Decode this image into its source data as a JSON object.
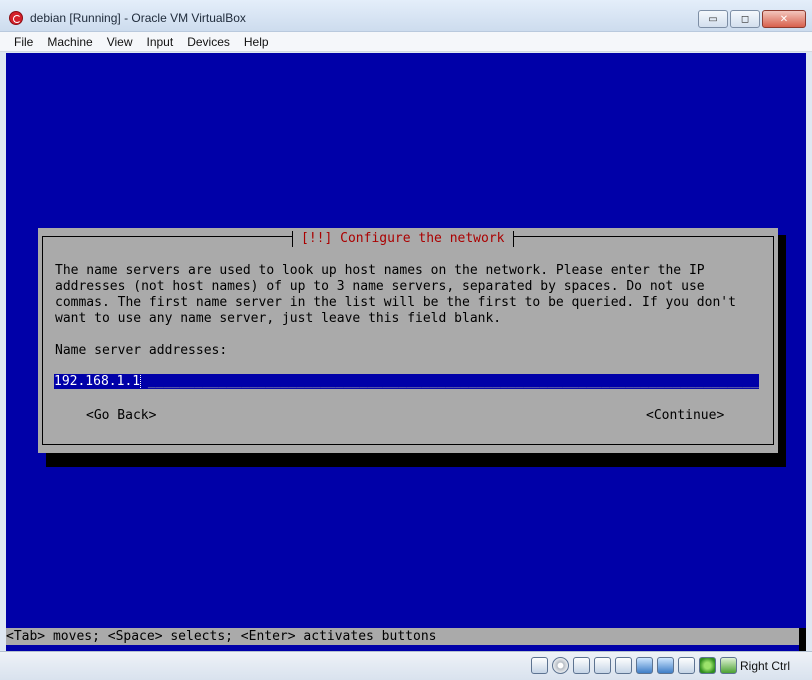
{
  "window": {
    "title": "debian [Running] - Oracle VM VirtualBox",
    "minimize": "▭",
    "maximize": "◻",
    "close": "✕"
  },
  "menu": {
    "file": "File",
    "machine": "Machine",
    "view": "View",
    "input": "Input",
    "devices": "Devices",
    "help": "Help"
  },
  "dialog": {
    "title": "[!!] Configure the network",
    "description": "The name servers are used to look up host names on the network. Please enter the IP\naddresses (not host names) of up to 3 name servers, separated by spaces. Do not use\ncommas. The first name server in the list will be the first to be queried. If you don't\nwant to use any name server, just leave this field blank.",
    "field_label": "Name server addresses:",
    "field_value": "192.168.1.1",
    "field_fill": "_______________________________________________________________________________",
    "go_back": "<Go Back>",
    "continue": "<Continue>"
  },
  "helpbar": {
    "text": "<Tab> moves; <Space> selects; <Enter> activates buttons"
  },
  "statusbar": {
    "host_key": "Right Ctrl",
    "icons": [
      "hard-disk-icon",
      "optical-disc-icon",
      "usb-icon",
      "pencil-icon",
      "shared-folder-icon",
      "display-icon",
      "network-icon",
      "recording-icon",
      "mouse-integration-icon",
      "host-key-arrow-icon"
    ]
  },
  "colors": {
    "screen_bg": "#0000a8",
    "dialog_bg": "#aaaaaa",
    "dialog_title": "#aa0000",
    "field_bg": "#0000a8"
  }
}
